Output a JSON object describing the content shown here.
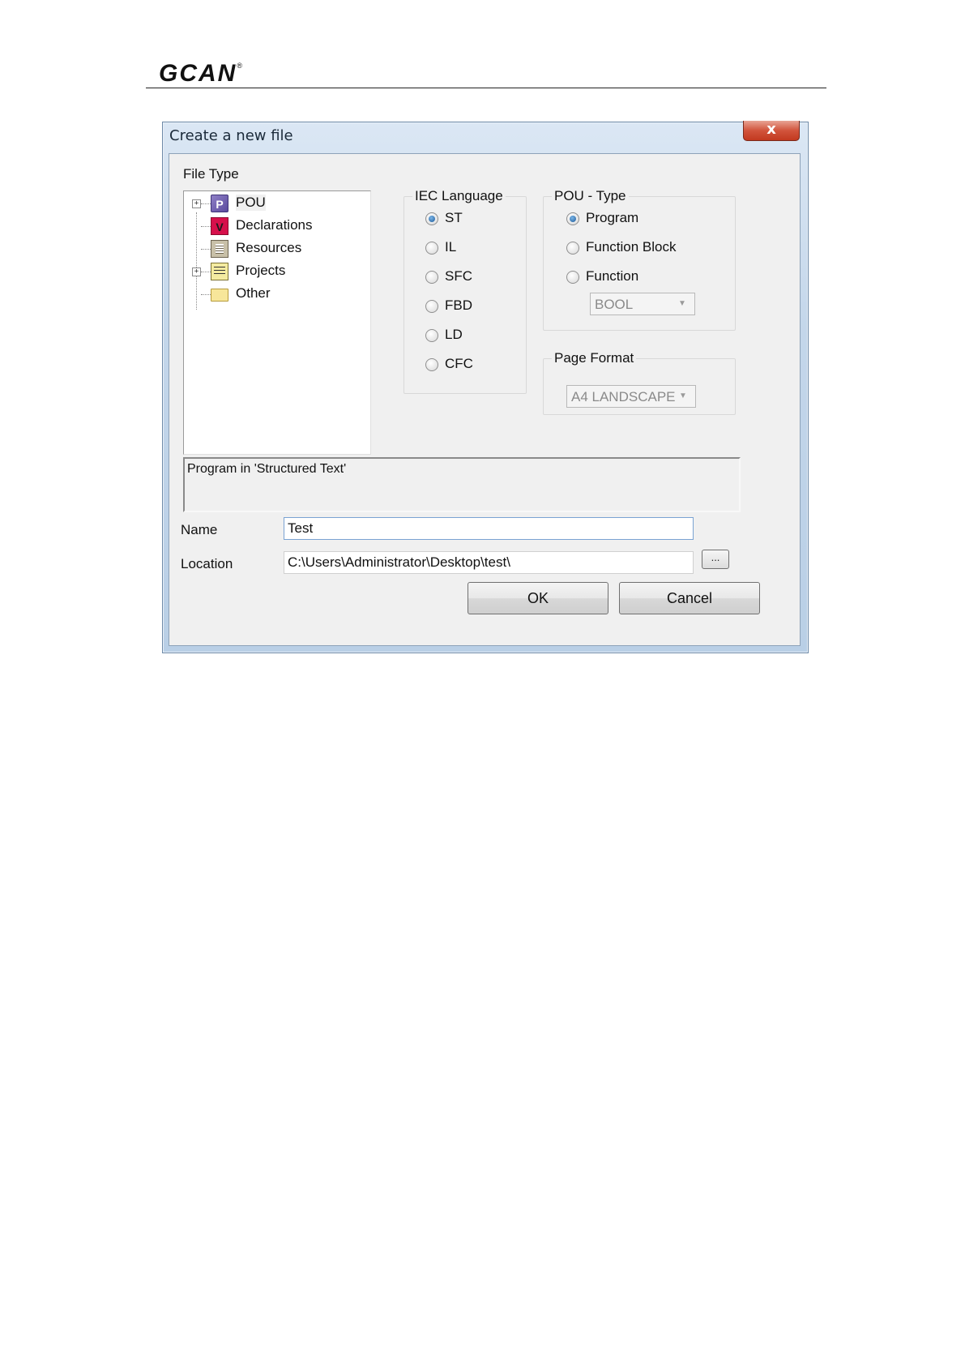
{
  "header": {
    "logo_text": "GCAN",
    "logo_mark": "®"
  },
  "dialog": {
    "title": "Create a new file",
    "close_symbol": "x",
    "file_type_label": "File Type",
    "tree": [
      {
        "label": "POU",
        "icon": "pou-icon",
        "glyph": "P",
        "expandable": true
      },
      {
        "label": "Declarations",
        "icon": "declarations-icon",
        "glyph": "V",
        "expandable": false
      },
      {
        "label": "Resources",
        "icon": "resources-icon",
        "glyph": "",
        "expandable": false
      },
      {
        "label": "Projects",
        "icon": "projects-icon",
        "glyph": "",
        "expandable": true
      },
      {
        "label": "Other",
        "icon": "folder-icon",
        "glyph": "",
        "expandable": false
      }
    ],
    "iec_language": {
      "title": "IEC Language",
      "options": [
        "ST",
        "IL",
        "SFC",
        "FBD",
        "LD",
        "CFC"
      ],
      "selected": "ST"
    },
    "pou_type": {
      "title": "POU - Type",
      "options": [
        "Program",
        "Function Block",
        "Function"
      ],
      "selected": "Program",
      "return_type": "BOOL"
    },
    "page_format": {
      "title": "Page Format",
      "value": "A4 LANDSCAPE"
    },
    "description": "Program in 'Structured Text'",
    "name_label": "Name",
    "name_value": "Test",
    "location_label": "Location",
    "location_value": "C:\\Users\\Administrator\\Desktop\\test\\",
    "browse_label": "...",
    "ok_label": "OK",
    "cancel_label": "Cancel"
  }
}
